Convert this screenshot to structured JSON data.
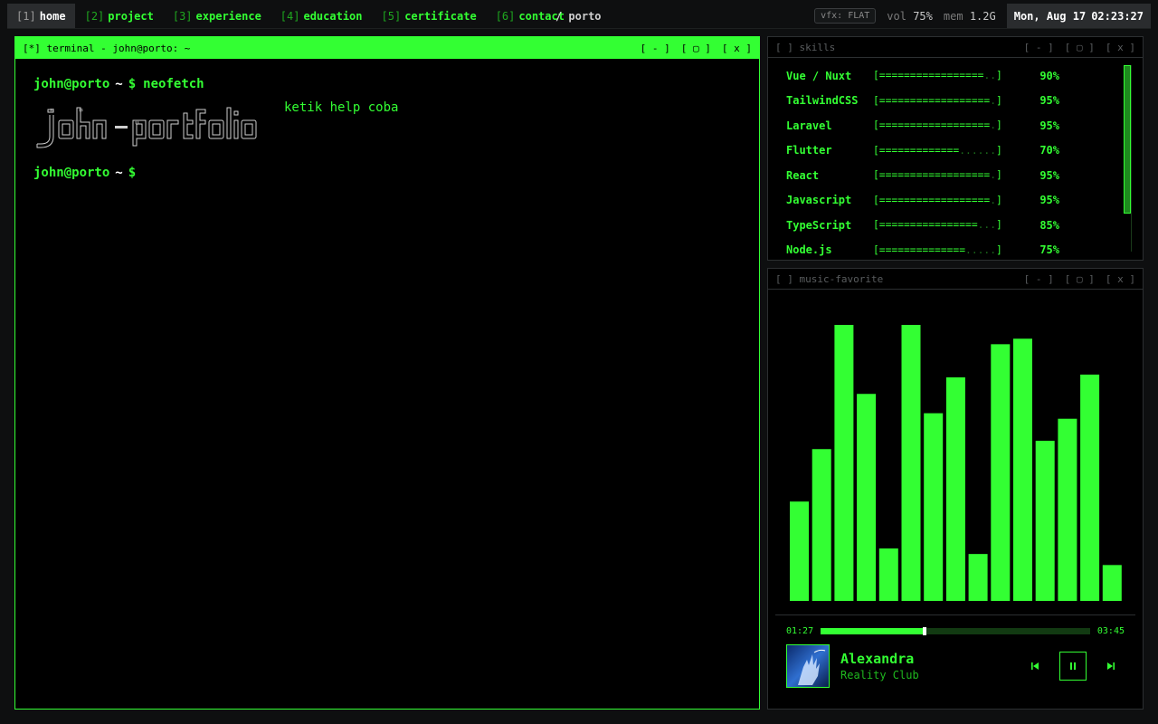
{
  "topbar": {
    "workspaces": [
      {
        "num": "[1]",
        "label": "home"
      },
      {
        "num": "[2]",
        "label": "project"
      },
      {
        "num": "[3]",
        "label": "experience"
      },
      {
        "num": "[4]",
        "label": "education"
      },
      {
        "num": "[5]",
        "label": "certificate"
      },
      {
        "num": "[6]",
        "label": "contact"
      }
    ],
    "app_label": "/ porto",
    "vfx": "vfx: FLAT",
    "vol_label": "vol",
    "vol_value": "75%",
    "mem_label": "mem",
    "mem_value": "1.2G",
    "date": "Mon, Aug 17",
    "time": "02:23:27"
  },
  "window_controls": {
    "minimize": "[ - ]",
    "maximize": "[ ▢ ]",
    "close": "[ x ]"
  },
  "terminal": {
    "title": "[*] terminal - john@porto: ~",
    "user": "john@porto",
    "tilde": "~",
    "dollar": "$",
    "command": "neofetch",
    "ascii_art": "johnporto",
    "info": "ketik help coba"
  },
  "skills": {
    "title": "[ ] skills",
    "items": [
      {
        "name": "Vue / Nuxt",
        "percent": 90,
        "pct_label": "90%"
      },
      {
        "name": "TailwindCSS",
        "percent": 95,
        "pct_label": "95%"
      },
      {
        "name": "Laravel",
        "percent": 95,
        "pct_label": "95%"
      },
      {
        "name": "Flutter",
        "percent": 70,
        "pct_label": "70%"
      },
      {
        "name": "React",
        "percent": 95,
        "pct_label": "95%"
      },
      {
        "name": "Javascript",
        "percent": 95,
        "pct_label": "95%"
      },
      {
        "name": "TypeScript",
        "percent": 85,
        "pct_label": "85%"
      },
      {
        "name": "Node.js",
        "percent": 75,
        "pct_label": "75%"
      }
    ]
  },
  "music": {
    "title": "[ ] music-favorite",
    "visualizer_levels": [
      0.36,
      0.55,
      1.0,
      0.75,
      0.19,
      1.0,
      0.68,
      0.81,
      0.17,
      0.93,
      0.95,
      0.58,
      0.66,
      0.82,
      0.13
    ],
    "elapsed": "01:27",
    "duration": "03:45",
    "progress": 0.386,
    "track_title": "Alexandra",
    "artist": "Reality Club",
    "cover_script": "Alexandra"
  },
  "colors": {
    "accent": "#33ff33",
    "background": "#000000",
    "frame": "#0e0f10"
  }
}
